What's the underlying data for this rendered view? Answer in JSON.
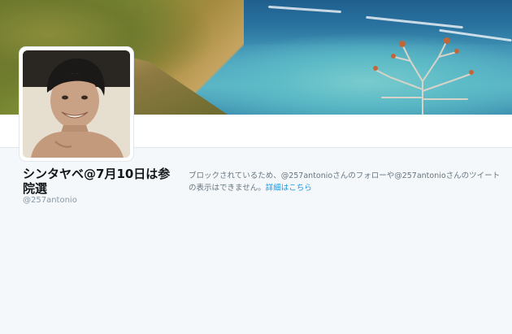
{
  "profile": {
    "name": "シンタヤベ@7月10日は参院選",
    "handle": "@257antonio"
  },
  "blocked_notice": {
    "message": "ブロックされているため、@257antonioさんのフォローや@257antonioさんのツイートの表示はできません。",
    "link_label": "詳細はこちら"
  },
  "colors": {
    "link": "#1b95e0",
    "background": "#f5f8fa",
    "name_text": "#14171a",
    "muted_text": "#66757f",
    "handle_text": "#8899a6"
  },
  "icons": {
    "banner": "header-photo",
    "avatar": "profile-photo"
  }
}
